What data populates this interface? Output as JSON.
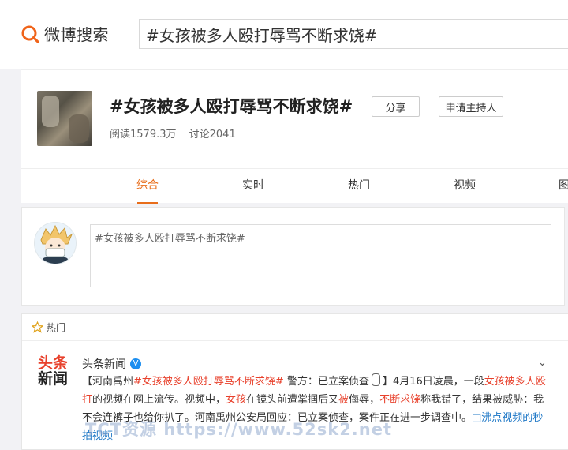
{
  "header": {
    "logo_text": "微博搜索",
    "search_value": "#女孩被多人殴打辱骂不断求饶#"
  },
  "topic": {
    "title": "#女孩被多人殴打辱骂不断求饶#",
    "share_label": "分享",
    "host_label": "申请主持人",
    "reads": "阅读1579.3万",
    "discussions": "讨论2041"
  },
  "tabs": [
    "综合",
    "实时",
    "热门",
    "视频",
    "图"
  ],
  "active_tab": "综合",
  "compose": {
    "placeholder": "#女孩被多人殴打辱骂不断求饶#"
  },
  "feed": {
    "section_label": "热门",
    "post": {
      "source_logo_line1": "头条",
      "source_logo_line2": "新闻",
      "author": "头条新闻",
      "verified_mark": "V",
      "segments": {
        "s1": "【河南禹州",
        "tag1": "#女孩被多人殴打辱骂不断求饶#",
        "s2": " 警方：已立案侦查",
        "s3": "】4月16日凌晨，一段",
        "hl1": "女孩被多人殴打",
        "s4": "的视频在网上流传。视频中，",
        "hl2": "女孩",
        "s5": "在镜头前遭掌掴后又",
        "hl3": "被",
        "s6": "侮辱，",
        "hl4": "不断求饶",
        "s7": "称我错了，",
        "s8": "结果被威胁：我不会连裤子也给你扒了。河南禹州公安局回应：已立案侦查，案件正在进一步调查中。",
        "link": "□沸点视频的秒拍视频"
      }
    }
  },
  "watermark": "TCT资源 https://www.52sk2.net"
}
